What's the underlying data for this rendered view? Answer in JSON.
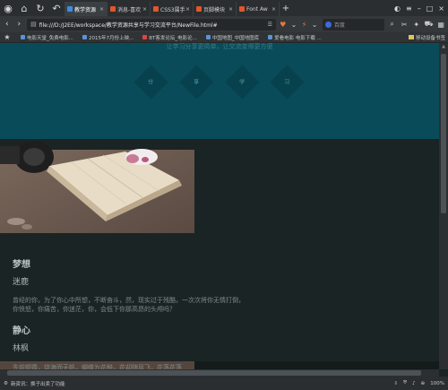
{
  "tabs": [
    {
      "label": "教学资源",
      "active": true
    },
    {
      "label": "消息-喜欢",
      "active": false
    },
    {
      "label": "CSS3属手",
      "active": false
    },
    {
      "label": "页脚模块",
      "active": false
    },
    {
      "label": "Font Aw",
      "active": false
    }
  ],
  "address": {
    "url": "file:///D:/J2EE/workspace/教学资源共享与学习交流平台/NewFile.html#",
    "search_placeholder": "百度"
  },
  "bookmarks": [
    "电影天堂_免费电影...",
    "2015年7月份上映...",
    "BT客发论坛_电影论...",
    "中国地图_中国地图库",
    "爱看电影 电影下载 ..."
  ],
  "bookmarks_right": "移动设备书签",
  "hero": {
    "caption": "让学习分享更简单，让交流变得更方便",
    "diamonds": [
      "分",
      "享",
      "学",
      "习"
    ]
  },
  "sections": [
    {
      "title": "梦想",
      "subtitle": "迷鹿",
      "body": "曾经的你，为了你心中所想，不断奋斗，然，现实过于残酷，一次次将你无情打倒，你愤怒，你痛苦，你迷茫，你，会低下你那高昂的头颅吗？"
    },
    {
      "title": "静心",
      "subtitle": "林枫",
      "body": "先前顿霞，烧海而无帆，蝴蝶为花醉，花却随风飞，花落花落"
    }
  ],
  "status": {
    "left": "新资讯：换子出卖了功能",
    "zoom": "100%"
  }
}
